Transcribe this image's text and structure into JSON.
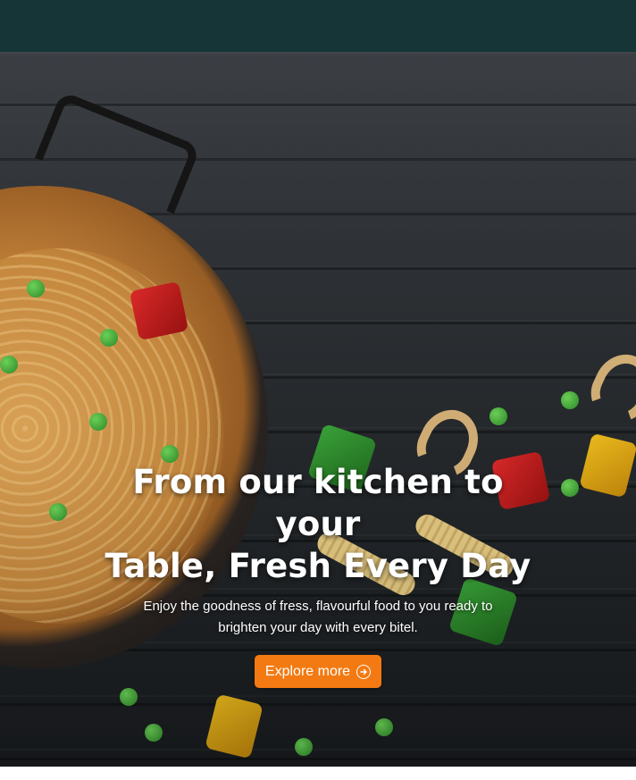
{
  "hero": {
    "title_line1": "From our kitchen to your",
    "title_line2": "Table, Fresh Every Day",
    "subtitle_line1": "Enjoy the goodness of fress, flavourful food to you ready to",
    "subtitle_line2": "brighten your day with every bitel.",
    "cta_label": "Explore more",
    "cta_icon": "arrow-right-circle-icon"
  },
  "colors": {
    "header_bg": "#153536",
    "cta_bg": "#f37a12",
    "text": "#ffffff"
  }
}
